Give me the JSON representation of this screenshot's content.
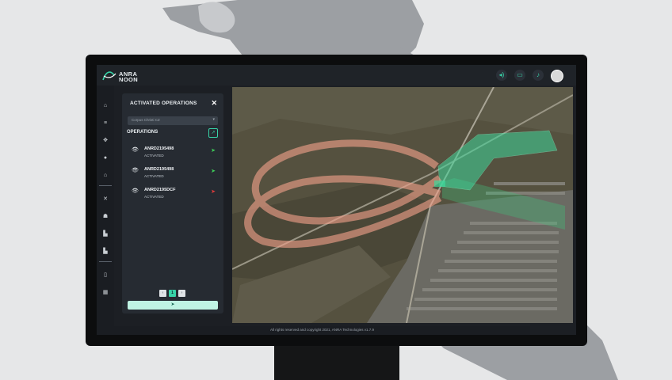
{
  "brand": {
    "line1": "ANRA",
    "line2": "NOON",
    "accent": "#37d3a7"
  },
  "topbar": {
    "icons": [
      "speaker-icon",
      "chat-icon",
      "bell-icon"
    ],
    "icon_glyphs": [
      "◂)",
      "▭",
      "♪"
    ]
  },
  "sidebar": {
    "items": [
      {
        "name": "home-icon",
        "glyph": "⌂"
      },
      {
        "name": "list-icon",
        "glyph": "≡"
      },
      {
        "name": "drone-icon",
        "glyph": "✥"
      },
      {
        "name": "globe-icon",
        "glyph": "●"
      },
      {
        "name": "building-icon",
        "glyph": "⌂"
      },
      {
        "name": "tools-icon",
        "glyph": "✕"
      },
      {
        "name": "user-icon",
        "glyph": "☗"
      },
      {
        "name": "document-icon",
        "glyph": "▙"
      },
      {
        "name": "report-icon",
        "glyph": "▙"
      },
      {
        "name": "phone-icon",
        "glyph": "▯"
      },
      {
        "name": "grid-icon",
        "glyph": "▦"
      }
    ]
  },
  "panel": {
    "title": "ACTIVATED OPERATIONS",
    "close": "✕",
    "select_value": "Corpus Christi CZ",
    "select_caret": "▾",
    "ops_label": "OPERATIONS",
    "ops_button": "↗",
    "operations": [
      {
        "id": "ANRD2195498",
        "status": "ACTIVATED",
        "plane_color": "#3ecf5a"
      },
      {
        "id": "ANRD2195498",
        "status": "ACTIVATED",
        "plane_color": "#3ecf5a"
      },
      {
        "id": "ANRD2195DCF",
        "status": "ACTIVATED",
        "plane_color": "#e23b3b"
      }
    ],
    "pager": {
      "prev": "‹",
      "current": "1",
      "next": "›"
    },
    "send_glyph": "➤"
  },
  "footer": {
    "text": "All rights reserved and copyright 2021, ANRA Technologies v1.7.9"
  }
}
